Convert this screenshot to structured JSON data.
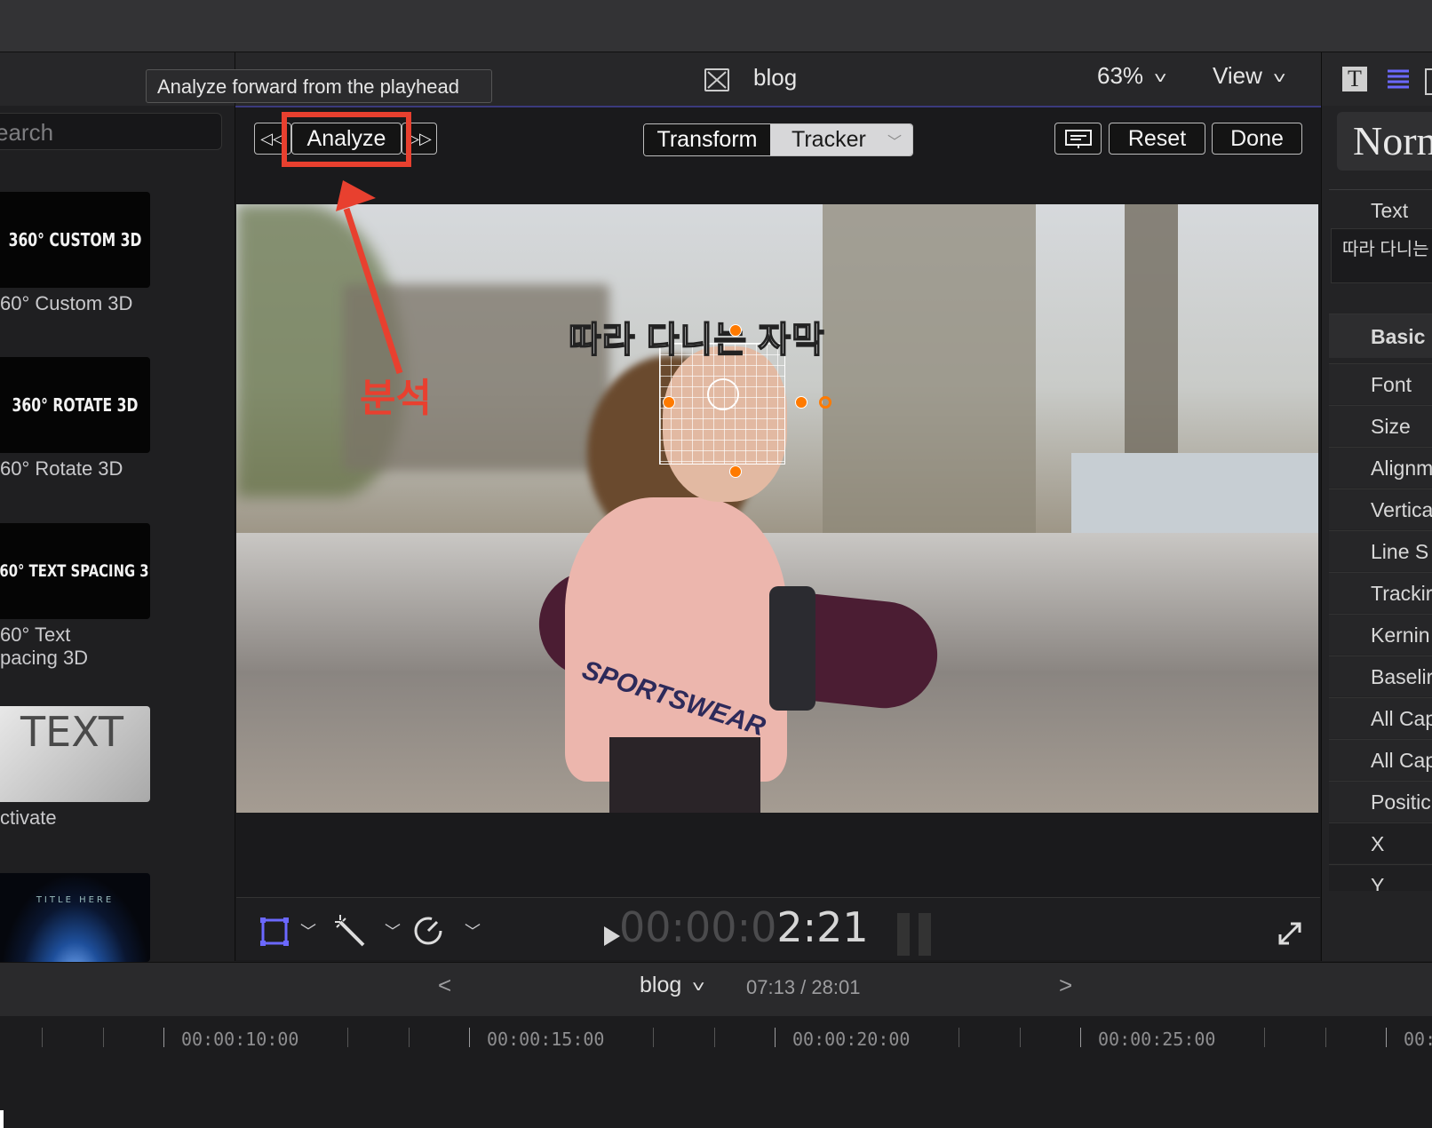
{
  "tooltip": "Analyze forward from the playhead",
  "browser": {
    "search_placeholder": "earch",
    "items": [
      {
        "thumb": "360° CUSTOM 3D",
        "caption": "60° Custom 3D"
      },
      {
        "thumb": "360° ROTATE 3D",
        "caption": "60° Rotate 3D"
      },
      {
        "thumb": "360° TEXT SPACING 3D",
        "caption": "60° Text\npacing 3D"
      },
      {
        "thumb": "TEXT",
        "caption": "ctivate"
      },
      {
        "thumb": "TITLE HERE",
        "caption": ""
      }
    ]
  },
  "viewer": {
    "project_name": "blog",
    "zoom": "63%",
    "view_label": "View",
    "toolbar": {
      "prev_label": "◁◁",
      "analyze_label": "Analyze",
      "next_label": "▷▷",
      "segment_transform": "Transform",
      "segment_tracker": "Tracker",
      "reset_label": "Reset",
      "done_label": "Done"
    },
    "subtitle_text": "따라 다니는 자막",
    "annotation": "분석",
    "clothing_text": "SPORTSWEAR",
    "timecode_dim": "00:00:0",
    "timecode_bright": "2:21"
  },
  "inspector": {
    "preset": "Norn",
    "text_label": "Text",
    "text_value": "따라 다니는",
    "section_basic": "Basic",
    "rows": [
      "Font",
      "Size",
      "Alignm",
      "Vertica",
      "Line S",
      "Trackir",
      "Kernin",
      "Baselir",
      "All Cap",
      "All Cap",
      "Positic",
      "X",
      "Y"
    ]
  },
  "timeline": {
    "project_name": "blog",
    "time_readout": "07:13 / 28:01",
    "ruler_labels": [
      "00:00:10:00",
      "00:00:15:00",
      "00:00:20:00",
      "00:00:25:00",
      "00:"
    ]
  },
  "colors": {
    "annotation_red": "#e8402f",
    "tracker_handle": "#ff7a00",
    "accent_purple": "#3b3a7d"
  },
  "icons": [
    "crop-transform-icon",
    "magic-wand-icon",
    "speed-icon",
    "play-icon",
    "fullscreen-icon",
    "text-inspector-icon",
    "paragraph-icon",
    "close-project-icon"
  ]
}
